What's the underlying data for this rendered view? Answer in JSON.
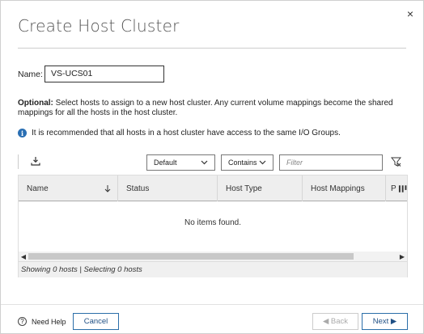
{
  "dialog": {
    "title": "Create Host Cluster",
    "close_glyph": "×"
  },
  "name_field": {
    "label": "Name:",
    "value": "VS-UCS01"
  },
  "description": {
    "bold": "Optional:",
    "text": " Select hosts to assign to a new host cluster. Any current volume mappings become the shared mappings for all the hosts in the host cluster."
  },
  "info": {
    "icon": "info-icon",
    "text": "It is recommended that all hosts in a host cluster have access to the same I/O Groups."
  },
  "toolbar": {
    "export_icon": "download-icon",
    "view_select": "Default",
    "match_select": "Contains",
    "filter_placeholder": "Filter",
    "clear_filter_icon": "clear-filter-icon"
  },
  "table": {
    "columns": [
      "Name",
      "Status",
      "Host Type",
      "Host Mappings",
      "P"
    ],
    "empty_message": "No items found.",
    "footer": "Showing 0 hosts | Selecting 0 hosts"
  },
  "footer": {
    "help_label": "Need Help",
    "cancel_label": "Cancel",
    "back_label": "◀ Back",
    "next_label": "Next ▶"
  },
  "colors": {
    "accent": "#2b6ea9",
    "info": "#2a6fb3",
    "header_bg": "#eeeeee"
  }
}
